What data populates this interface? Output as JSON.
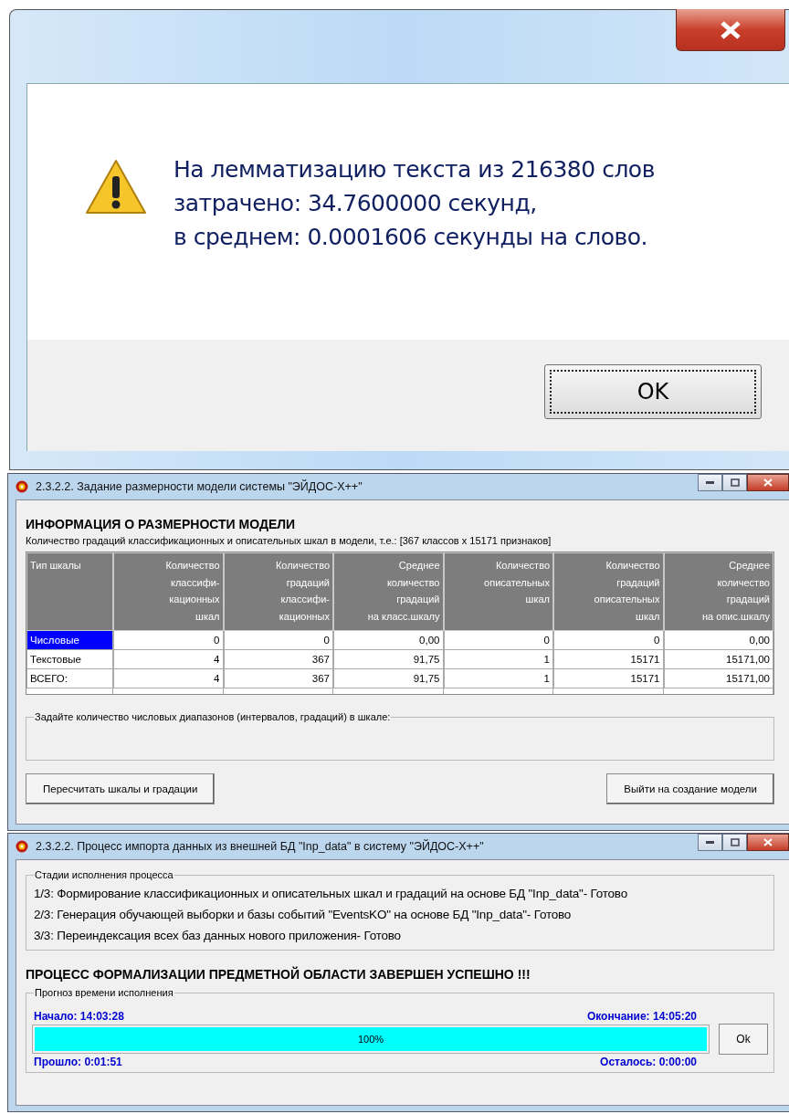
{
  "message_dialog": {
    "lines": [
      "На лемматизацию текста из 216380 слов",
      "затрачено: 34.7600000 секунд,",
      "в среднем: 0.0001606 секунды на слово."
    ],
    "ok_button": "OK"
  },
  "dimension_window": {
    "title": "2.3.2.2. Задание размерности модели системы \"ЭЙДОС-X++\"",
    "heading": "ИНФОРМАЦИЯ О РАЗМЕРНОСТИ МОДЕЛИ",
    "subtitle": "Количество градаций классификационных и описательных шкал в модели, т.е.: [367 классов x 15171 признаков]",
    "table": {
      "columns": [
        "Тип шкалы",
        "Количество\nклассифи-\nкационных\nшкал",
        "Количество\nградаций\nклассифи-\nкационных",
        "Среднее\nколичество\nградаций\nна класс.шкалу",
        "Количество\nописательных\nшкал",
        "Количество\nградаций\nописательных\nшкал",
        "Среднее\nколичество\nградаций\nна опис.шкалу"
      ],
      "rows": [
        {
          "selected": true,
          "cells": [
            "Числовые",
            "0",
            "0",
            "0,00",
            "0",
            "0",
            "0,00"
          ]
        },
        {
          "selected": false,
          "cells": [
            "Текстовые",
            "4",
            "367",
            "91,75",
            "1",
            "15171",
            "15171,00"
          ]
        },
        {
          "selected": false,
          "cells": [
            "ВСЕГО:",
            "4",
            "367",
            "91,75",
            "1",
            "15171",
            "15171,00"
          ]
        }
      ]
    },
    "group_label": "Задайте количество числовых диапазонов (интервалов, градаций) в шкале:",
    "buttons": [
      "Пересчитать шкалы и градации",
      "Выйти на создание модели"
    ]
  },
  "import_window": {
    "title": "2.3.2.2. Процесс импорта данных из внешней БД \"Inp_data\" в систему \"ЭЙДОС-X++\"",
    "stages_label": "Стадии исполнения процесса",
    "stages": [
      "1/3: Формирование классификационных и описательных шкал и градаций на основе БД \"Inp_data\"- Готово",
      "2/3: Генерация обучающей выборки и базы событий \"EventsKO\" на основе БД \"Inp_data\"- Готово",
      "3/3: Переиндексация всех баз данных нового приложения- Готово"
    ],
    "status": "ПРОЦЕСС ФОРМАЛИЗАЦИИ ПРЕДМЕТНОЙ ОБЛАСТИ ЗАВЕРШЕН УСПЕШНО !!!",
    "forecast_label": "Прогноз времени исполнения",
    "start": "Начало: 14:03:28",
    "end": "Окончание: 14:05:20",
    "progress": {
      "level": 1,
      "text": "100%"
    },
    "elapsed": "Прошло: 0:01:51",
    "remaining": "Осталось: 0:00:00",
    "ok_button": "Ok"
  }
}
